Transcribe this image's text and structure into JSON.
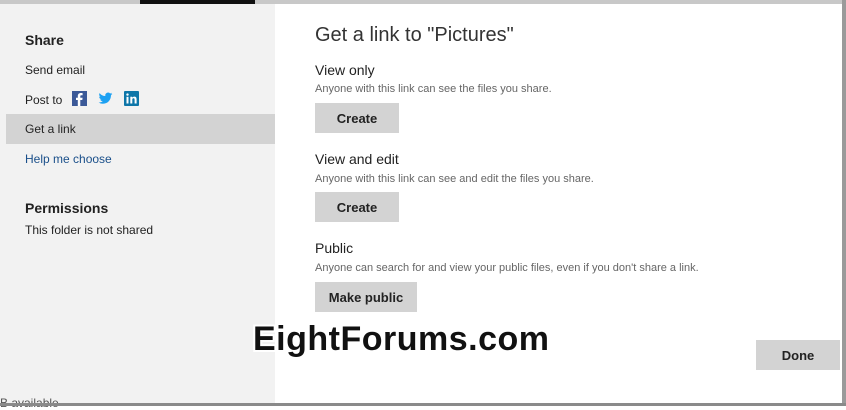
{
  "sidebar": {
    "share_heading": "Share",
    "send_email": "Send email",
    "post_to": "Post to",
    "social": [
      "facebook-icon",
      "twitter-icon",
      "linkedin-icon"
    ],
    "get_link": "Get a link",
    "help_choose": "Help me choose",
    "permissions_heading": "Permissions",
    "folder_status": "This folder is not shared",
    "partial_text": "B available"
  },
  "main": {
    "title": "Get a link to \"Pictures\"",
    "view_only": {
      "title": "View only",
      "desc": "Anyone with this link can see the files you share.",
      "button": "Create"
    },
    "view_edit": {
      "title": "View and edit",
      "desc": "Anyone with this link can see and edit the files you share.",
      "button": "Create"
    },
    "public": {
      "title": "Public",
      "desc": "Anyone can search for and view your public files, even if you don't share a link.",
      "button": "Make public"
    },
    "done_button": "Done"
  },
  "watermark": "EightForums.com",
  "colors": {
    "sidebar_bg": "#f2f2f2",
    "selected_bg": "#d3d3d3",
    "button_bg": "#d3d3d3",
    "link": "#1a4f8a",
    "facebook": "#3b5998",
    "twitter": "#1da1f2",
    "linkedin": "#0e76a8"
  }
}
